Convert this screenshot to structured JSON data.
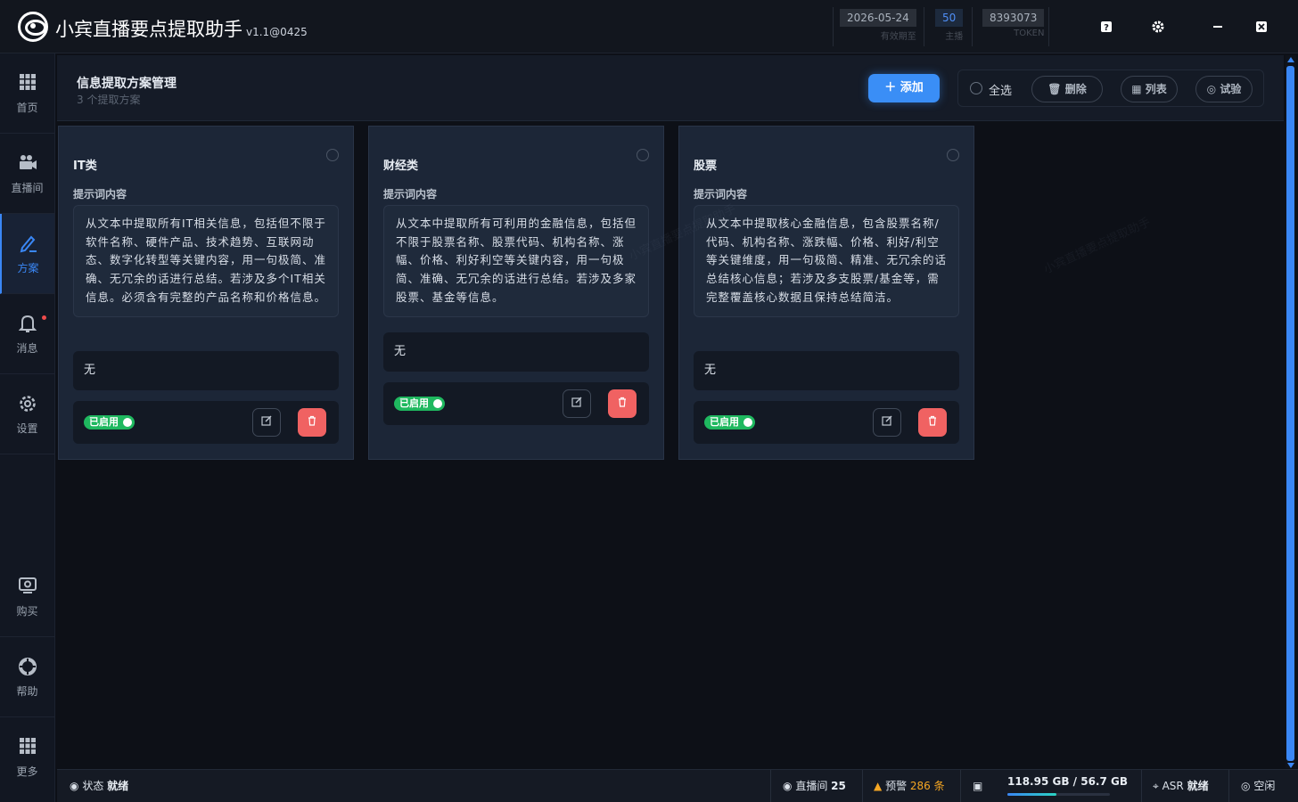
{
  "app": {
    "title": "小宾直播要点提取助手",
    "version": "v1.1@0425",
    "watermark": "小宾直播要点提取助手"
  },
  "titlebar": {
    "stats": [
      {
        "value": "2026-05-24",
        "label": "有效期至"
      },
      {
        "value": "50",
        "label": "主播"
      },
      {
        "value": "8393073",
        "label": "TOKEN"
      }
    ]
  },
  "sidebar": {
    "items": [
      {
        "label": "首页",
        "icon": "grid-icon"
      },
      {
        "label": "直播间",
        "icon": "camera-icon"
      },
      {
        "label": "方案",
        "icon": "pen-icon",
        "active": true
      },
      {
        "label": "消息",
        "icon": "bell-icon"
      },
      {
        "label": "设置",
        "icon": "gear-icon"
      },
      {
        "label": "购买",
        "icon": "purchase-icon"
      },
      {
        "label": "帮助",
        "icon": "help-icon"
      },
      {
        "label": "更多",
        "icon": "more-grid-icon"
      }
    ]
  },
  "header": {
    "title": "信息提取方案管理",
    "subtitle": "3 个提取方案",
    "add_label": "添加",
    "select_all": "全选",
    "delete_label": "删除",
    "list_label": "列表",
    "test_label": "试验"
  },
  "cards": [
    {
      "title": "IT类",
      "prompt_label": "提示词内容",
      "prompt": "从文本中提取所有IT相关信息，包括但不限于软件名称、硬件产品、技术趋势、互联网动态、数字化转型等关键内容，用一句极简、准确、无冗余的话进行总结。若涉及多个IT相关信息。必须含有完整的产品名称和价格信息。",
      "note": "无",
      "status": "已启用"
    },
    {
      "title": "财经类",
      "prompt_label": "提示词内容",
      "prompt": "从文本中提取所有可利用的金融信息，包括但不限于股票名称、股票代码、机构名称、涨幅、价格、利好利空等关键内容，用一句极简、准确、无冗余的话进行总结。若涉及多家股票、基金等信息。",
      "note": "无",
      "status": "已启用"
    },
    {
      "title": "股票",
      "prompt_label": "提示词内容",
      "prompt": "从文本中提取核心金融信息，包含股票名称/代码、机构名称、涨跌幅、价格、利好/利空等关键维度，用一句极简、精准、无冗余的话总结核心信息；若涉及多支股票/基金等，需完整覆盖核心数据且保持总结简洁。",
      "note": "无",
      "status": "已启用"
    }
  ],
  "statusbar": {
    "status_label": "状态",
    "status_value": "就绪",
    "rooms_label": "直播间",
    "rooms_value": "25",
    "alert_label": "预警",
    "alert_value": "286 条",
    "disk": "118.95 GB / 56.7 GB",
    "disk_fraction": 0.48,
    "asr_label": "ASR",
    "asr_value": "就绪",
    "idle": "空闲"
  },
  "colors": {
    "accent": "#3a8ef6",
    "success": "#1fb85f",
    "danger": "#f06262",
    "warning": "#f5a623"
  }
}
